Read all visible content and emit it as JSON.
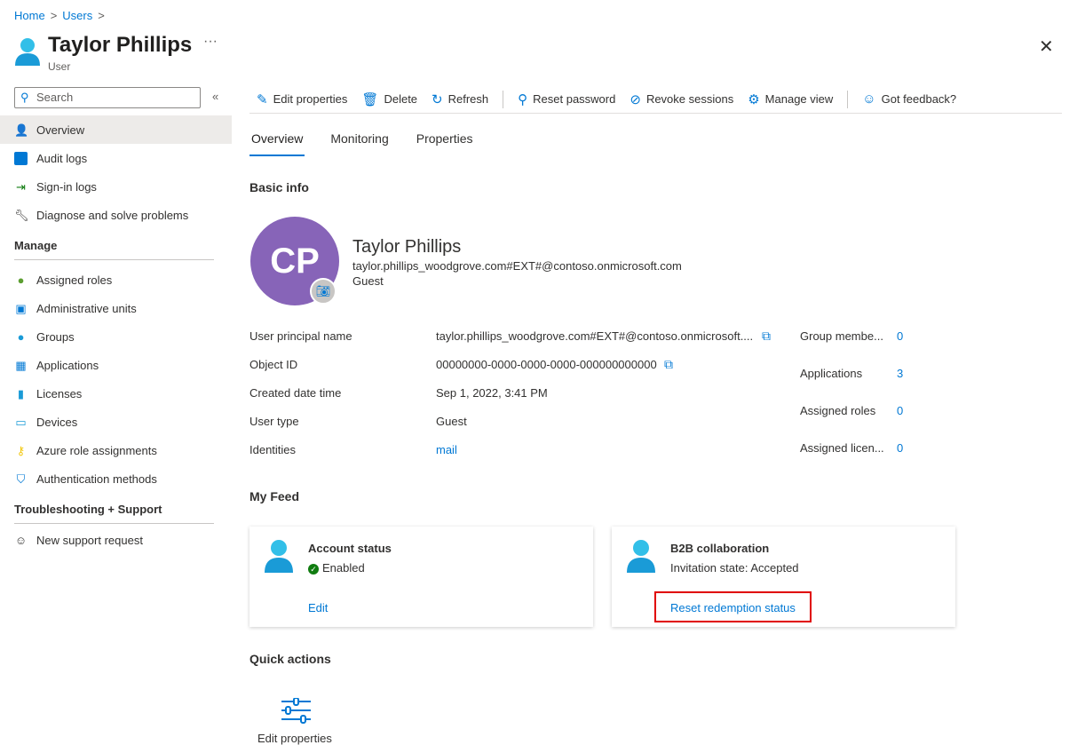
{
  "breadcrumb": [
    "Home",
    "Users"
  ],
  "header": {
    "title": "Taylor Phillips",
    "subtitle": "User",
    "more": "···",
    "close": "✕"
  },
  "sidebar": {
    "search_placeholder": "Search",
    "collapse": "«",
    "items": [
      {
        "label": "Overview",
        "icon": "user-icon"
      },
      {
        "label": "Audit logs",
        "icon": "log-icon"
      },
      {
        "label": "Sign-in logs",
        "icon": "sign-in-icon"
      },
      {
        "label": "Diagnose and solve problems",
        "icon": "wrench-icon"
      }
    ],
    "manage_heading": "Manage",
    "manage": [
      {
        "label": "Assigned roles",
        "icon": "roles-icon"
      },
      {
        "label": "Administrative units",
        "icon": "admin-units-icon"
      },
      {
        "label": "Groups",
        "icon": "groups-icon"
      },
      {
        "label": "Applications",
        "icon": "apps-icon"
      },
      {
        "label": "Licenses",
        "icon": "licenses-icon"
      },
      {
        "label": "Devices",
        "icon": "devices-icon"
      },
      {
        "label": "Azure role assignments",
        "icon": "key-icon"
      },
      {
        "label": "Authentication methods",
        "icon": "shield-icon"
      }
    ],
    "support_heading": "Troubleshooting + Support",
    "support": [
      {
        "label": "New support request",
        "icon": "support-icon"
      }
    ]
  },
  "toolbar": {
    "edit": "Edit properties",
    "delete": "Delete",
    "refresh": "Refresh",
    "reset_password": "Reset password",
    "revoke": "Revoke sessions",
    "manage_view": "Manage view",
    "feedback": "Got feedback?"
  },
  "tabs": [
    "Overview",
    "Monitoring",
    "Properties"
  ],
  "basic_info": {
    "heading": "Basic info",
    "initials": "CP",
    "name": "Taylor Phillips",
    "email": "taylor.phillips_woodgrove.com#EXT#@contoso.onmicrosoft.com",
    "type": "Guest",
    "fields": [
      {
        "label": "User principal name",
        "value": "taylor.phillips_woodgrove.com#EXT#@contoso.onmicrosoft...."
      },
      {
        "label": "Object ID",
        "value": "00000000-0000-0000-0000-000000000000"
      },
      {
        "label": "Created date time",
        "value": "Sep 1, 2022, 3:41 PM"
      },
      {
        "label": "User type",
        "value": "Guest"
      },
      {
        "label": "Identities",
        "value": "mail"
      }
    ],
    "stats": [
      {
        "label": "Group membe...",
        "value": "0"
      },
      {
        "label": "Applications",
        "value": "3"
      },
      {
        "label": "Assigned roles",
        "value": "0"
      },
      {
        "label": "Assigned licen...",
        "value": "0"
      }
    ]
  },
  "feed": {
    "heading": "My Feed",
    "account": {
      "title": "Account status",
      "status": "Enabled",
      "link": "Edit"
    },
    "b2b": {
      "title": "B2B collaboration",
      "status": "Invitation state: Accepted",
      "link": "Reset redemption status"
    }
  },
  "quick_actions": {
    "heading": "Quick actions",
    "item": "Edit properties"
  },
  "colors": {
    "accent": "#0078d4",
    "avatar": "#8764b8",
    "highlight": "#e00000"
  }
}
